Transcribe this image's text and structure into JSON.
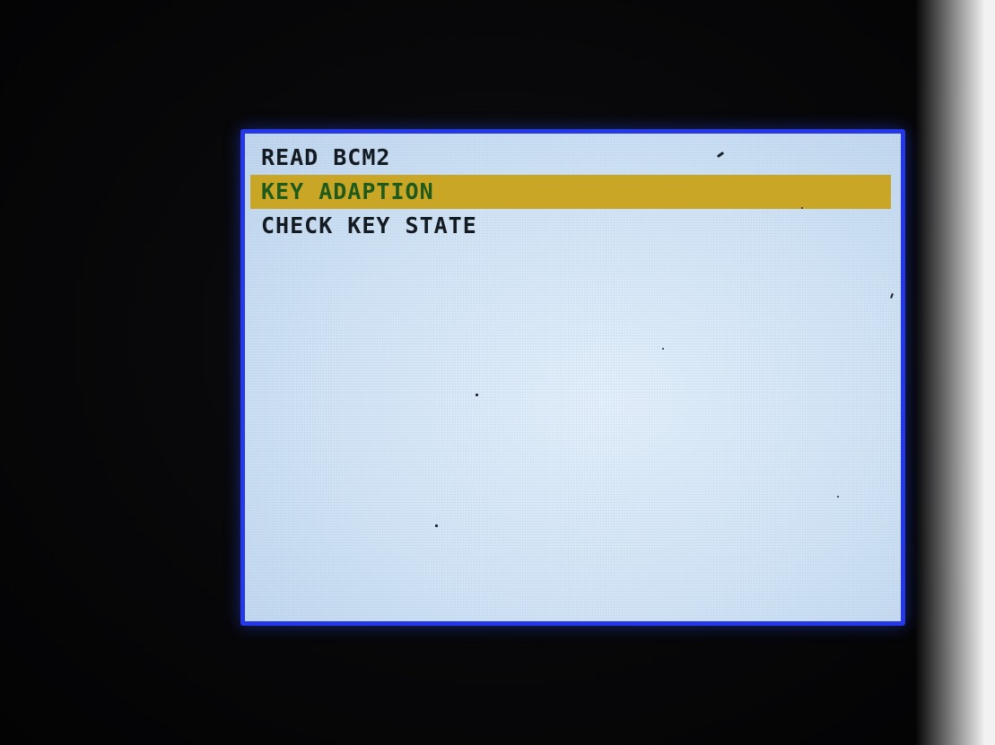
{
  "menu": {
    "items": [
      {
        "label": "READ BCM2",
        "selected": false
      },
      {
        "label": "KEY ADAPTION",
        "selected": true
      },
      {
        "label": "CHECK KEY STATE",
        "selected": false
      }
    ]
  },
  "colors": {
    "screen_background": "#d2e4f5",
    "screen_border": "#2438e8",
    "highlight_background": "#c9a626",
    "highlight_text": "#1f5a1c",
    "text": "#141a22",
    "bezel": "#060608"
  }
}
